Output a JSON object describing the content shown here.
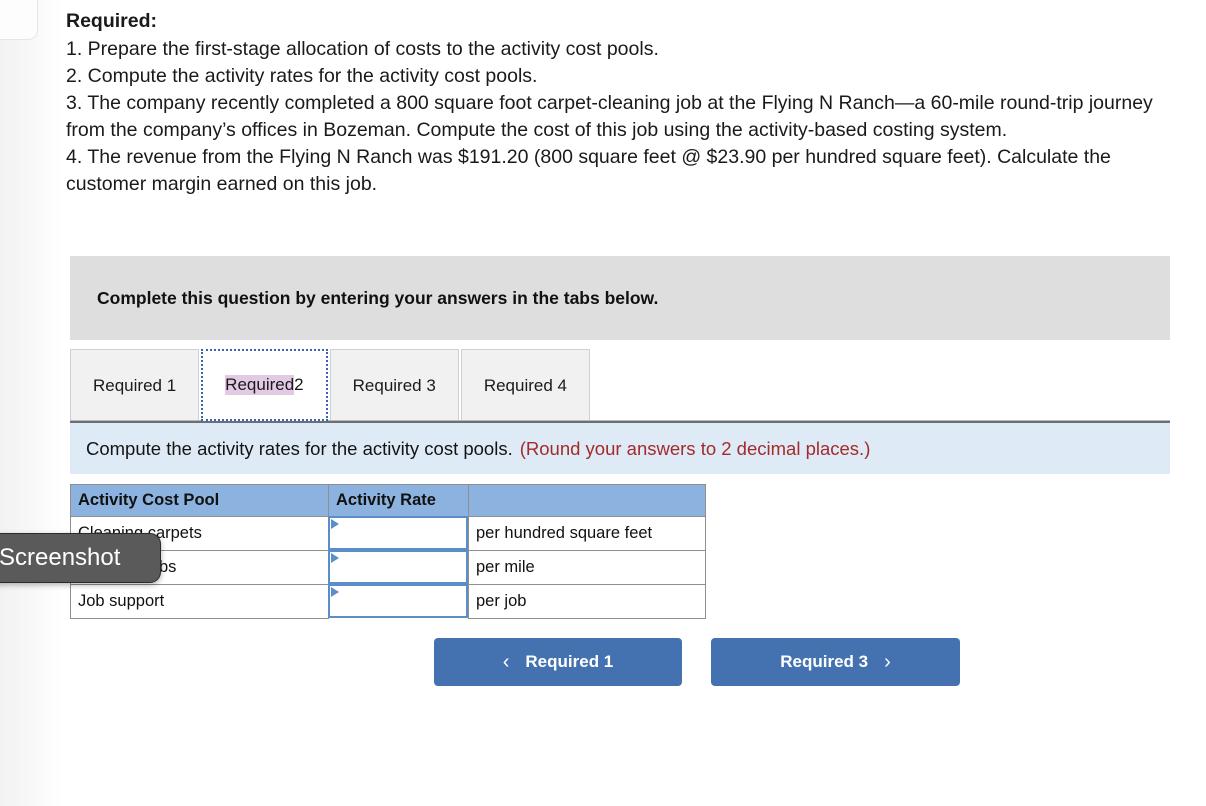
{
  "prose": {
    "heading": "Required:",
    "items": [
      "1. Prepare the first-stage allocation of costs to the activity cost pools.",
      "2. Compute the activity rates for the activity cost pools.",
      "3. The company recently completed a 800 square foot carpet-cleaning job at the Flying N Ranch—a 60-mile round-trip journey from the company’s offices in Bozeman. Compute the cost of this job using the activity-based costing system.",
      "4. The revenue from the Flying N Ranch was $191.20 (800 square feet @ $23.90 per hundred square feet). Calculate the customer margin earned on this job."
    ]
  },
  "banner": {
    "text": "Complete this question by entering your answers in the tabs below."
  },
  "tabs": [
    {
      "label": "Required 1",
      "active": false
    },
    {
      "label_selected": "Required",
      "label_rest": " 2",
      "active": true
    },
    {
      "label": "Required 3",
      "active": false
    },
    {
      "label": "Required 4",
      "active": false
    }
  ],
  "instruction": {
    "text": "Compute the activity rates for the activity cost pools.",
    "note": "(Round your answers to 2 decimal places.)"
  },
  "table": {
    "headers": [
      "Activity Cost Pool",
      "Activity Rate",
      ""
    ],
    "rows": [
      {
        "pool": "Cleaning carpets",
        "rate": "",
        "unit": "per hundred square feet"
      },
      {
        "pool": "Travel to jobs",
        "rate": "",
        "unit": "per mile"
      },
      {
        "pool": "Job support",
        "rate": "",
        "unit": "per job"
      }
    ]
  },
  "nav": {
    "prev_label": "Required 1",
    "prev_icon": "chevron-left-icon",
    "prev_chevron": "‹",
    "next_label": "Required 3",
    "next_icon": "chevron-right-icon",
    "next_chevron": "›"
  },
  "overlay": {
    "screenshot_label": "Screenshot"
  },
  "colors": {
    "banner_gray": "#dedede",
    "instruction_blue": "#deeaf6",
    "note_red": "#a32b2b",
    "table_header_blue": "#8cb3e0",
    "input_border_blue": "#5b8dc8",
    "button_blue": "#4472b0",
    "tab_selection_lavender": "#e2c9e4",
    "tooltip_gray": "#5a5a5a"
  }
}
